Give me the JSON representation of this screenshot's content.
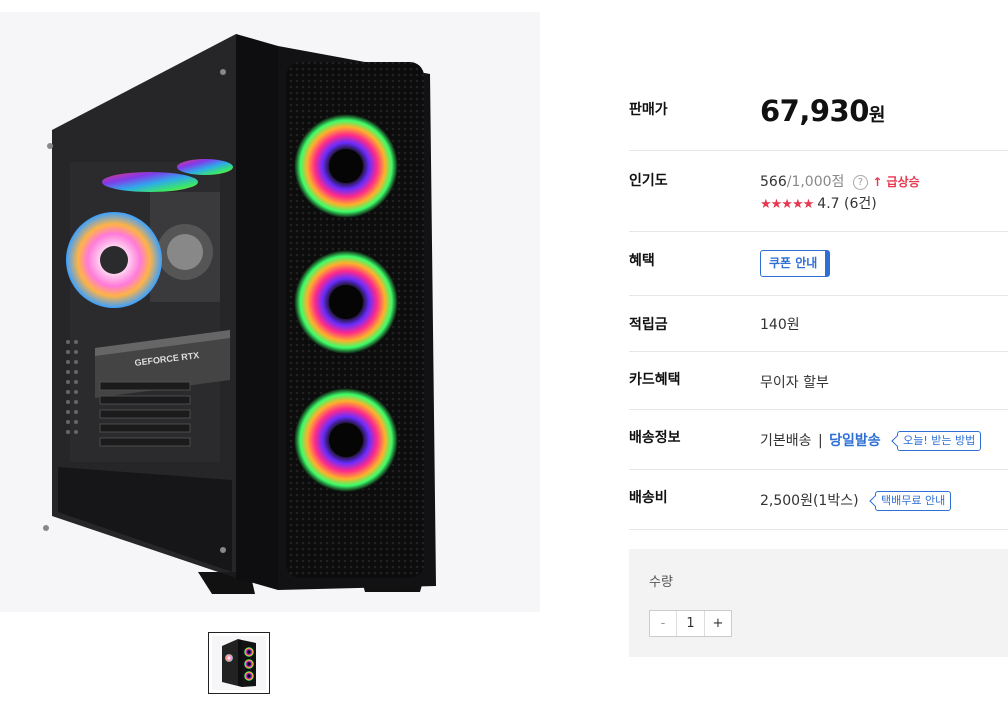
{
  "product": {
    "image_alt_icon": "pc-case-image",
    "thumbnail_icon": "pc-case-thumbnail",
    "gpu_label": "GEFORCE RTX"
  },
  "info": {
    "price": {
      "label": "판매가",
      "amount": "67,930",
      "unit": "원"
    },
    "popularity": {
      "label": "인기도",
      "current": "566",
      "max": "/1,000점",
      "help": "?",
      "trend": "↑ 급상승",
      "stars": "★★★★★",
      "rating": "4.7 (6건)"
    },
    "benefit": {
      "label": "혜택",
      "coupon_button": "쿠폰 안내"
    },
    "points": {
      "label": "적립금",
      "value": "140원"
    },
    "card": {
      "label": "카드혜택",
      "value": "무이자 할부"
    },
    "shipping": {
      "label": "배송정보",
      "basic": "기본배송",
      "separator": "|",
      "same_day": "당일발송",
      "link": "오늘! 받는 방법"
    },
    "fee": {
      "label": "배송비",
      "value": "2,500원(1박스)",
      "link": "택배무료 안내"
    }
  },
  "quantity": {
    "label": "수량",
    "minus": "-",
    "value": "1",
    "plus": "+"
  },
  "colors": {
    "accent_blue": "#2e6fd6",
    "trend_red": "#e8384f",
    "qty_bg": "#f3f3f3"
  }
}
